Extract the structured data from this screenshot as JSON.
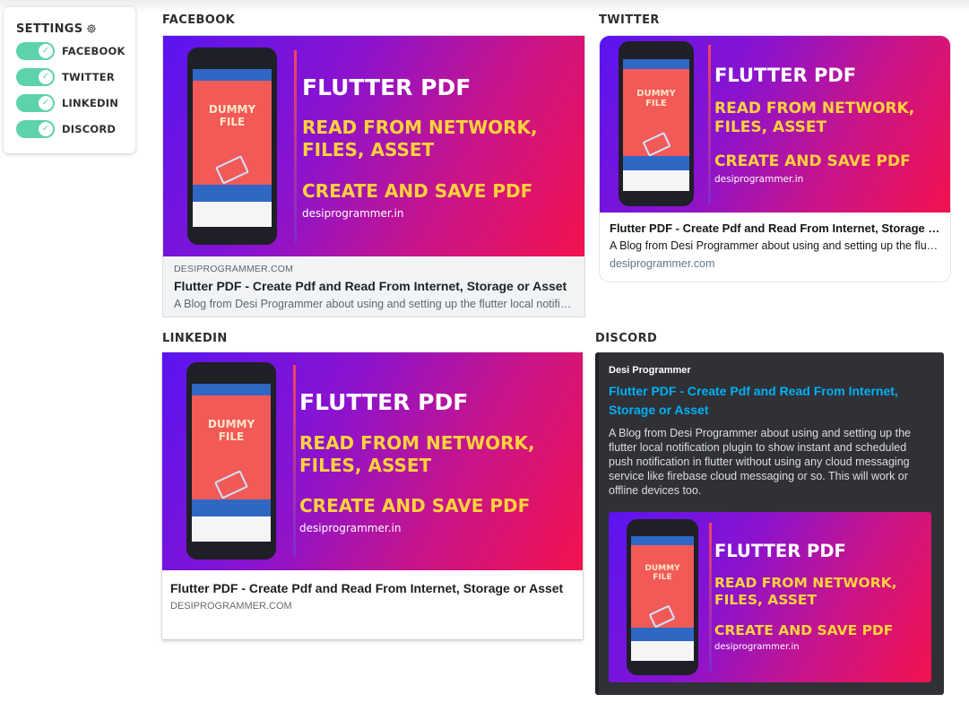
{
  "settings": {
    "title": "SETTINGS",
    "toggles": [
      {
        "label": "FACEBOOK",
        "on": true
      },
      {
        "label": "TWITTER",
        "on": true
      },
      {
        "label": "LINKEDIN",
        "on": true
      },
      {
        "label": "DISCORD",
        "on": true
      }
    ],
    "check_glyph": "✓",
    "accent": "#5cd3a8"
  },
  "banner": {
    "headline": "FLUTTER PDF",
    "line1": "READ FROM NETWORK,",
    "line2": "FILES, ASSET",
    "line3": "CREATE AND SAVE PDF",
    "site": "desiprogrammer.in",
    "phone_text1": "DUMMY",
    "phone_text2": "FILE"
  },
  "facebook": {
    "section": "FACEBOOK",
    "domain": "DESIPROGRAMMER.COM",
    "title": "Flutter PDF - Create Pdf and Read From Internet, Storage or Asset",
    "description": "A Blog from Desi Programmer about using and setting up the flutter local notification plugin to show instant and scheduled push notification"
  },
  "twitter": {
    "section": "TWITTER",
    "title": "Flutter PDF - Create Pdf and Read From Internet, Storage or Asset",
    "description": "A Blog from Desi Programmer about using and setting up the flutter local notification plugin",
    "domain": "desiprogrammer.com"
  },
  "linkedin": {
    "section": "LINKEDIN",
    "title": "Flutter PDF - Create Pdf and Read From Internet, Storage or Asset",
    "domain": "DESIPROGRAMMER.COM"
  },
  "discord": {
    "section": "DISCORD",
    "provider": "Desi Programmer",
    "title": "Flutter PDF - Create Pdf and Read From Internet, Storage or Asset",
    "description": "A Blog from Desi Programmer about using and setting up the flutter local notification plugin to show instant and scheduled push notification in flutter without using any cloud messaging service like firebase cloud messaging or so. This will work or offline devices too.",
    "link_color": "#00b0f4",
    "background": "#2f3136"
  }
}
